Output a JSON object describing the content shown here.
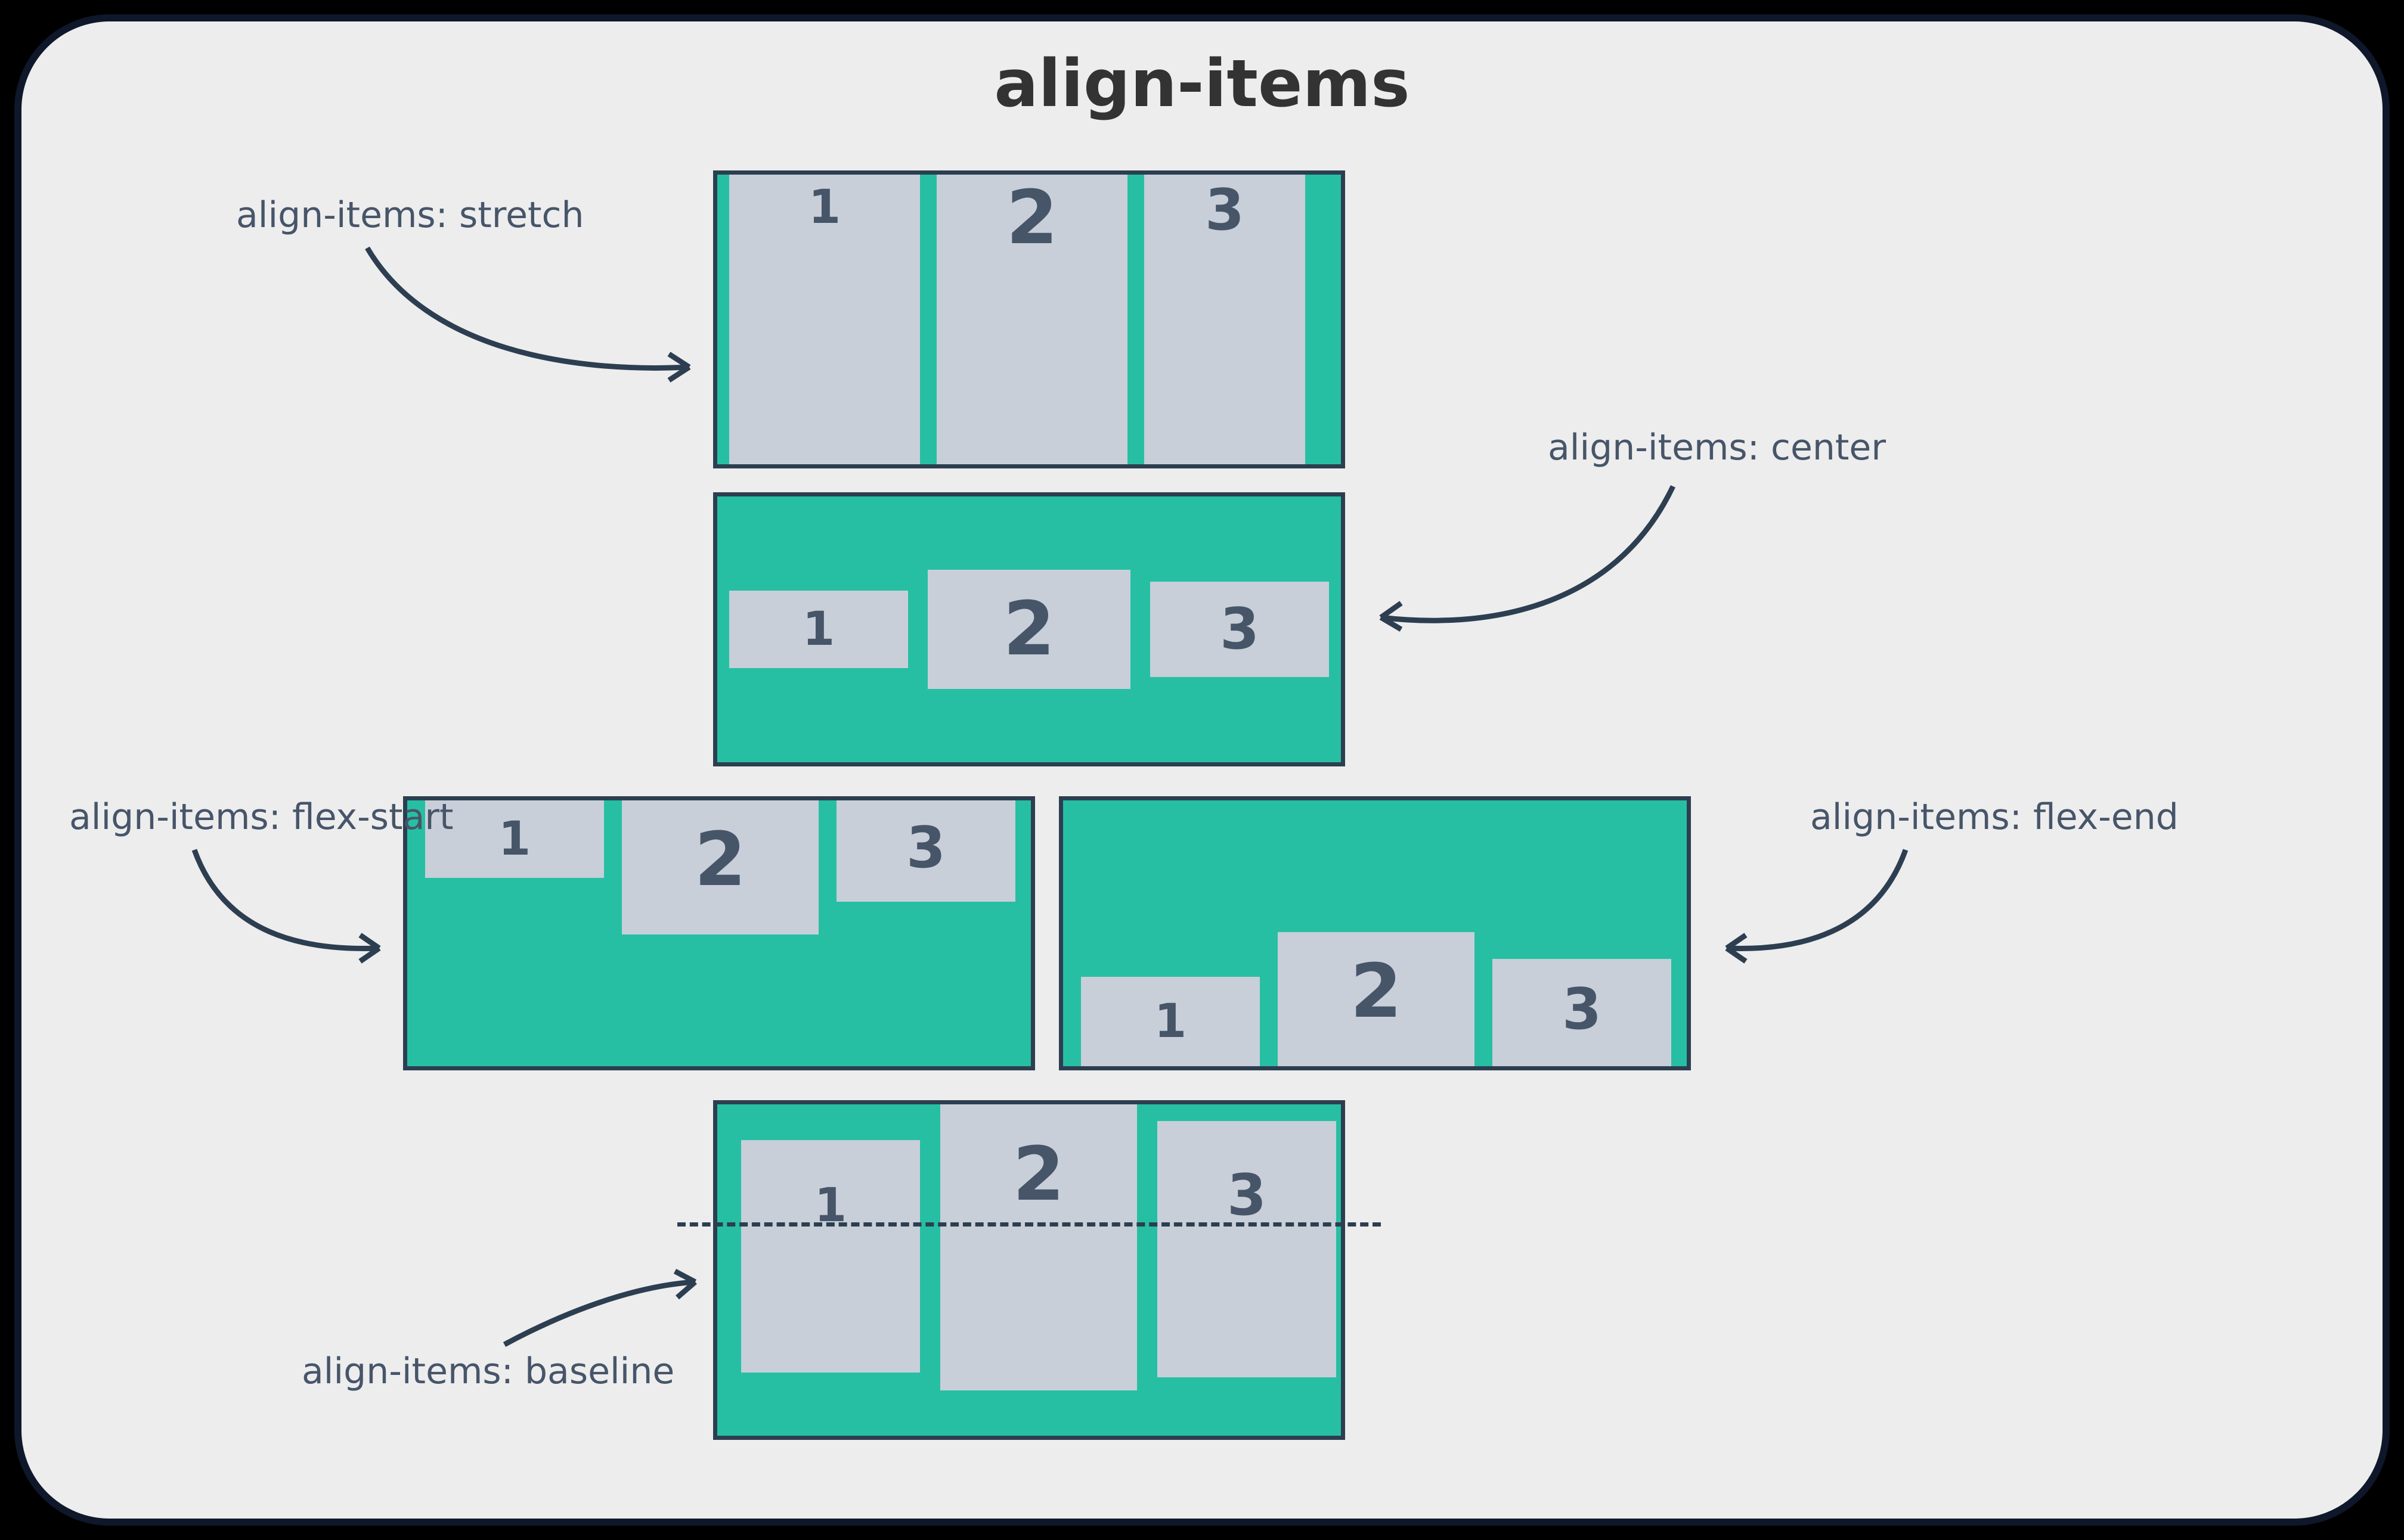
{
  "title": "align-items",
  "colors": {
    "teal": "#27BFA3",
    "item": "#C8CFD9",
    "outline": "#2C3E50",
    "page_bg": "#EDEDEE",
    "page_border": "#0F172A",
    "text": "#475569"
  },
  "examples": {
    "stretch": {
      "label": "align-items: stretch",
      "items": [
        "1",
        "2",
        "3"
      ]
    },
    "center": {
      "label": "align-items: center",
      "items": [
        "1",
        "2",
        "3"
      ]
    },
    "flex_start": {
      "label": "align-items: flex-start",
      "items": [
        "1",
        "2",
        "3"
      ]
    },
    "flex_end": {
      "label": "align-items: flex-end",
      "items": [
        "1",
        "2",
        "3"
      ]
    },
    "baseline": {
      "label": "align-items: baseline",
      "items": [
        "1",
        "2",
        "3"
      ]
    }
  }
}
